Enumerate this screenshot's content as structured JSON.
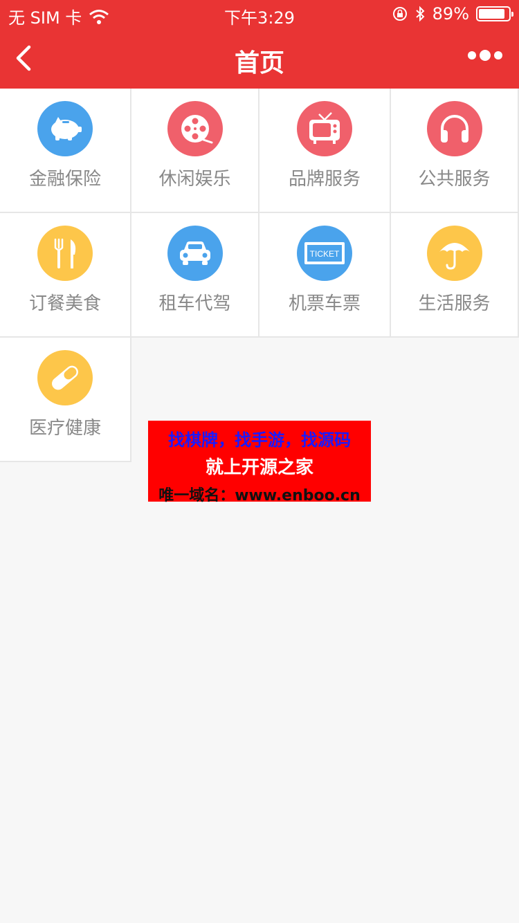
{
  "status_bar": {
    "carrier": "无 SIM 卡",
    "time": "下午3:29",
    "battery_text": "89%",
    "battery_level": 0.89,
    "icons": [
      "wifi-icon",
      "orientation-lock-icon",
      "bluetooth-icon",
      "battery-icon"
    ]
  },
  "nav": {
    "title": "首页",
    "back_icon": "chevron-left-icon",
    "more_icon": "more-dots-icon",
    "bg_color": "#e93434"
  },
  "grid": {
    "items": [
      {
        "label": "金融保险",
        "icon": "piggy-bank-icon",
        "color": "#4aa3ec"
      },
      {
        "label": "休闲娱乐",
        "icon": "film-reel-icon",
        "color": "#f0606b"
      },
      {
        "label": "品牌服务",
        "icon": "tv-icon",
        "color": "#f0606b"
      },
      {
        "label": "公共服务",
        "icon": "headphones-icon",
        "color": "#f0606b"
      },
      {
        "label": "订餐美食",
        "icon": "fork-knife-icon",
        "color": "#fdc64a"
      },
      {
        "label": "租车代驾",
        "icon": "car-icon",
        "color": "#4aa3ec"
      },
      {
        "label": "机票车票",
        "icon": "ticket-icon",
        "color": "#4aa3ec",
        "icon_text": "TICKET"
      },
      {
        "label": "生活服务",
        "icon": "umbrella-icon",
        "color": "#fdc64a"
      },
      {
        "label": "医疗健康",
        "icon": "pill-capsule-icon",
        "color": "#fdc64a"
      }
    ]
  },
  "ad": {
    "line1": "找棋牌，找手游，找源码",
    "line2": "就上开源之家",
    "line3": "唯一域名：www.enboo.cn"
  }
}
